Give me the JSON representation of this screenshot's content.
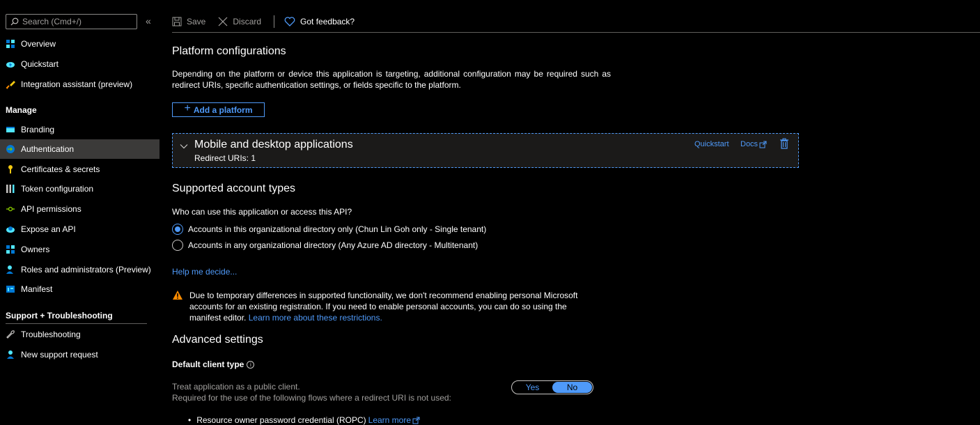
{
  "sidebar": {
    "search_placeholder": "Search (Cmd+/)",
    "collapse_glyph": "«",
    "items_top": [
      {
        "label": "Overview"
      },
      {
        "label": "Quickstart"
      },
      {
        "label": "Integration assistant (preview)"
      }
    ],
    "manage_header": "Manage",
    "items_manage": [
      {
        "label": "Branding"
      },
      {
        "label": "Authentication"
      },
      {
        "label": "Certificates & secrets"
      },
      {
        "label": "Token configuration"
      },
      {
        "label": "API permissions"
      },
      {
        "label": "Expose an API"
      },
      {
        "label": "Owners"
      },
      {
        "label": "Roles and administrators (Preview)"
      },
      {
        "label": "Manifest"
      }
    ],
    "support_header": "Support + Troubleshooting",
    "items_support": [
      {
        "label": "Troubleshooting"
      },
      {
        "label": "New support request"
      }
    ]
  },
  "toolbar": {
    "save_label": "Save",
    "discard_label": "Discard",
    "feedback_label": "Got feedback?"
  },
  "platform": {
    "title": "Platform configurations",
    "description": "Depending on the platform or device this application is targeting, additional configuration may be required such as redirect URIs, specific authentication settings, or fields specific to the platform.",
    "add_label": "Add a platform",
    "card": {
      "title": "Mobile and desktop applications",
      "subtitle": "Redirect URIs: 1",
      "quickstart_label": "Quickstart",
      "docs_label": "Docs"
    }
  },
  "accounts": {
    "title": "Supported account types",
    "question": "Who can use this application or access this API?",
    "option_single": "Accounts in this organizational directory only (Chun Lin Goh only - Single tenant)",
    "option_multi": "Accounts in any organizational directory (Any Azure AD directory - Multitenant)",
    "help_link": "Help me decide...",
    "warning_text": "Due to temporary differences in supported functionality, we don't recommend enabling personal Microsoft accounts for an existing registration. If you need to enable personal accounts, you can do so using the manifest editor.",
    "warning_link": "Learn more about these restrictions."
  },
  "advanced": {
    "title": "Advanced settings",
    "client_type_label": "Default client type",
    "info_glyph": "i",
    "public_client_line1": "Treat application as a public client.",
    "public_client_line2": "Required for the use of the following flows where a redirect URI is not used:",
    "toggle_yes": "Yes",
    "toggle_no": "No",
    "ropc_label": "Resource owner password credential (ROPC)",
    "learn_more": "Learn more"
  },
  "colors": {
    "accent": "#4f9af9",
    "active_bg": "#3b3a39",
    "warning": "#ff8c00"
  }
}
